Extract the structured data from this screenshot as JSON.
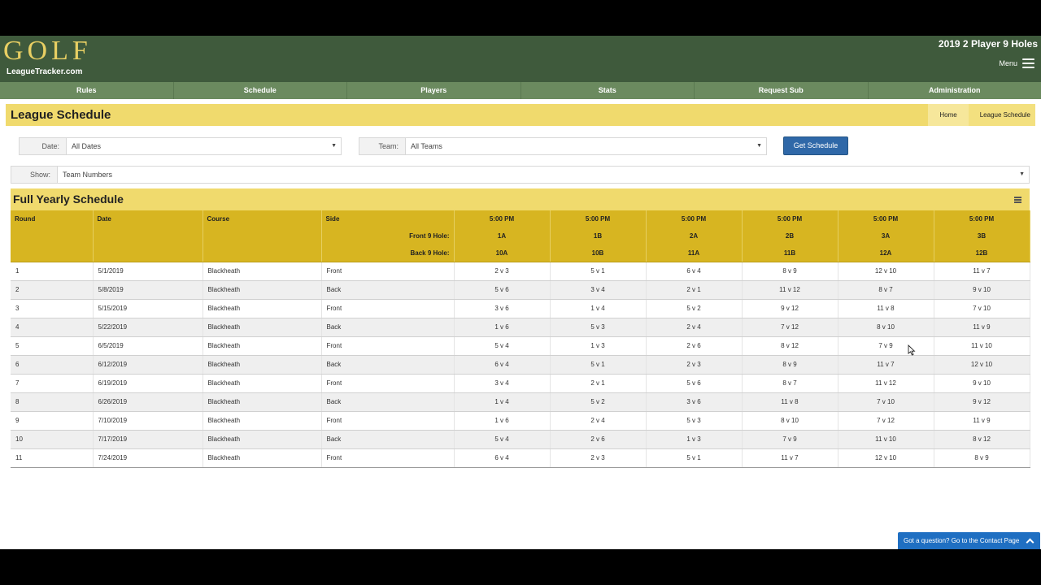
{
  "header": {
    "logo_text": "GOLF",
    "logo_site": "LeagueTracker.com",
    "league_name": "2019 2 Player 9 Holes",
    "menu_label": "Menu"
  },
  "nav": [
    {
      "label": "Rules"
    },
    {
      "label": "Schedule"
    },
    {
      "label": "Players"
    },
    {
      "label": "Stats"
    },
    {
      "label": "Request Sub"
    },
    {
      "label": "Administration"
    }
  ],
  "page": {
    "title": "League Schedule",
    "breadcrumb": [
      "Home",
      "League Schedule"
    ]
  },
  "filters": {
    "date_label": "Date:",
    "date_value": "All Dates",
    "team_label": "Team:",
    "team_value": "All Teams",
    "get_button": "Get Schedule",
    "show_label": "Show:",
    "show_value": "Team Numbers"
  },
  "schedule": {
    "title": "Full Yearly Schedule",
    "headers": {
      "round": "Round",
      "date": "Date",
      "course": "Course",
      "side": "Side"
    },
    "front_label": "Front 9 Hole:",
    "back_label": "Back 9 Hole:",
    "slots": [
      {
        "time": "5:00 PM",
        "front": "1A",
        "back": "10A"
      },
      {
        "time": "5:00 PM",
        "front": "1B",
        "back": "10B"
      },
      {
        "time": "5:00 PM",
        "front": "2A",
        "back": "11A"
      },
      {
        "time": "5:00 PM",
        "front": "2B",
        "back": "11B"
      },
      {
        "time": "5:00 PM",
        "front": "3A",
        "back": "12A"
      },
      {
        "time": "5:00 PM",
        "front": "3B",
        "back": "12B"
      }
    ],
    "rows": [
      {
        "round": "1",
        "date": "5/1/2019",
        "course": "Blackheath",
        "side": "Front",
        "matches": [
          "2 v 3",
          "5 v 1",
          "6 v 4",
          "8 v 9",
          "12 v 10",
          "11 v 7"
        ]
      },
      {
        "round": "2",
        "date": "5/8/2019",
        "course": "Blackheath",
        "side": "Back",
        "matches": [
          "5 v 6",
          "3 v 4",
          "2 v 1",
          "11 v 12",
          "8 v 7",
          "9 v 10"
        ]
      },
      {
        "round": "3",
        "date": "5/15/2019",
        "course": "Blackheath",
        "side": "Front",
        "matches": [
          "3 v 6",
          "1 v 4",
          "5 v 2",
          "9 v 12",
          "11 v 8",
          "7 v 10"
        ]
      },
      {
        "round": "4",
        "date": "5/22/2019",
        "course": "Blackheath",
        "side": "Back",
        "matches": [
          "1 v 6",
          "5 v 3",
          "2 v 4",
          "7 v 12",
          "8 v 10",
          "11 v 9"
        ]
      },
      {
        "round": "5",
        "date": "6/5/2019",
        "course": "Blackheath",
        "side": "Front",
        "matches": [
          "5 v 4",
          "1 v 3",
          "2 v 6",
          "8 v 12",
          "7 v 9",
          "11 v 10"
        ]
      },
      {
        "round": "6",
        "date": "6/12/2019",
        "course": "Blackheath",
        "side": "Back",
        "matches": [
          "6 v 4",
          "5 v 1",
          "2 v 3",
          "8 v 9",
          "11 v 7",
          "12 v 10"
        ]
      },
      {
        "round": "7",
        "date": "6/19/2019",
        "course": "Blackheath",
        "side": "Front",
        "matches": [
          "3 v 4",
          "2 v 1",
          "5 v 6",
          "8 v 7",
          "11 v 12",
          "9 v 10"
        ]
      },
      {
        "round": "8",
        "date": "6/26/2019",
        "course": "Blackheath",
        "side": "Back",
        "matches": [
          "1 v 4",
          "5 v 2",
          "3 v 6",
          "11 v 8",
          "7 v 10",
          "9 v 12"
        ]
      },
      {
        "round": "9",
        "date": "7/10/2019",
        "course": "Blackheath",
        "side": "Front",
        "matches": [
          "1 v 6",
          "2 v 4",
          "5 v 3",
          "8 v 10",
          "7 v 12",
          "11 v 9"
        ]
      },
      {
        "round": "10",
        "date": "7/17/2019",
        "course": "Blackheath",
        "side": "Back",
        "matches": [
          "5 v 4",
          "2 v 6",
          "1 v 3",
          "7 v 9",
          "11 v 10",
          "8 v 12"
        ]
      },
      {
        "round": "11",
        "date": "7/24/2019",
        "course": "Blackheath",
        "side": "Front",
        "matches": [
          "6 v 4",
          "2 v 3",
          "5 v 1",
          "11 v 7",
          "12 v 10",
          "8 v 9"
        ]
      }
    ]
  },
  "contact": {
    "label": "Got a question? Go to the Contact Page"
  },
  "colors": {
    "header_bg": "#3f5a3c",
    "nav_bg": "#6b8a5f",
    "title_bar": "#f0da6d",
    "table_header": "#d7b521",
    "button": "#2f68a8",
    "contact": "#1f6fc2"
  }
}
